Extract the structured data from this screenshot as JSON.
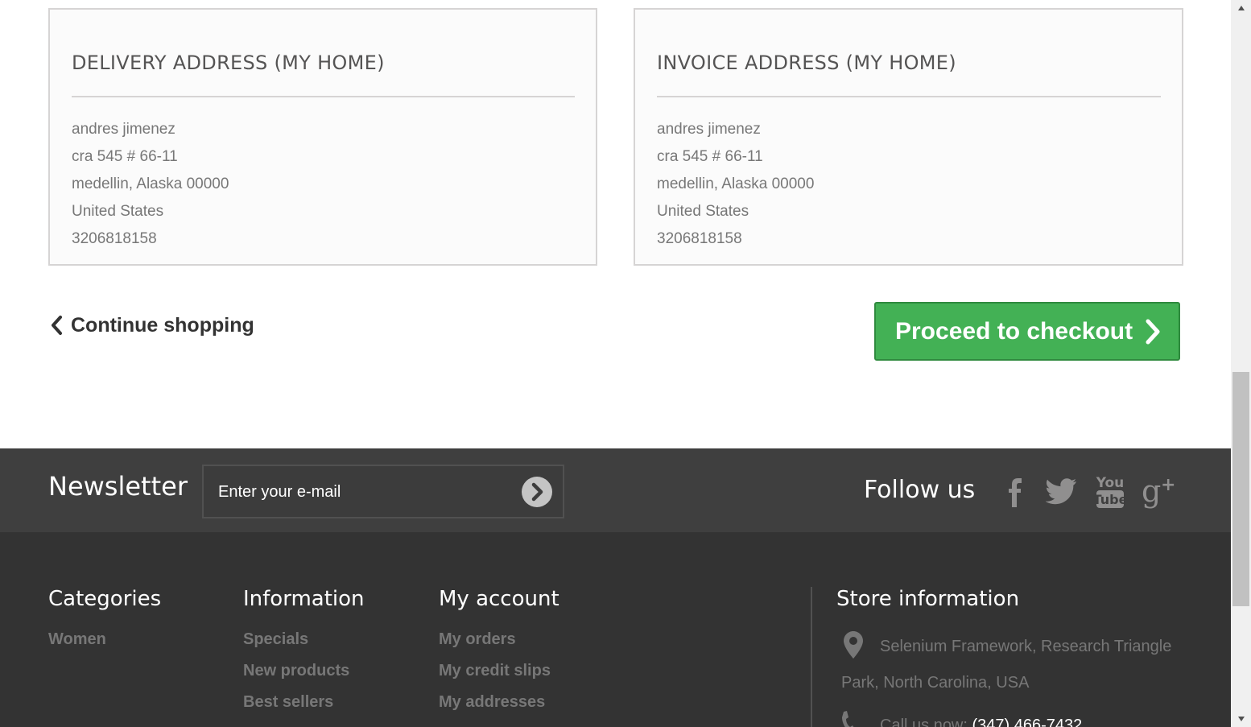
{
  "delivery": {
    "title": "DELIVERY ADDRESS (MY HOME)",
    "name": "andres jimenez",
    "street": "cra 545 # 66-11",
    "city": "medellin, Alaska 00000",
    "country": "United States",
    "phone": "3206818158"
  },
  "invoice": {
    "title": "INVOICE ADDRESS (MY HOME)",
    "name": "andres jimenez",
    "street": "cra 545 # 66-11",
    "city": "medellin, Alaska 00000",
    "country": "United States",
    "phone": "3206818158"
  },
  "actions": {
    "continue_label": "Continue shopping",
    "checkout_label": "Proceed to checkout"
  },
  "newsletter": {
    "title": "Newsletter",
    "placeholder": "Enter your e-mail",
    "submit_icon": "arrow-circle-right-icon"
  },
  "social": {
    "title": "Follow us",
    "icons": [
      "facebook-icon",
      "twitter-icon",
      "youtube-icon",
      "google-plus-icon"
    ]
  },
  "footer": {
    "categories": {
      "title": "Categories",
      "links": [
        "Women"
      ]
    },
    "information": {
      "title": "Information",
      "links": [
        "Specials",
        "New products",
        "Best sellers"
      ]
    },
    "account": {
      "title": "My account",
      "links": [
        "My orders",
        "My credit slips",
        "My addresses"
      ]
    },
    "store": {
      "title": "Store information",
      "address_line1": "Selenium Framework, Research Triangle",
      "address_line2": "Park, North Carolina, USA",
      "phone_label": "Call us now:",
      "phone_value": "(347) 466-7432"
    }
  },
  "colors": {
    "checkout_green": "#43b155",
    "footer_top": "#3f3f3f",
    "footer_bottom": "#333333"
  }
}
